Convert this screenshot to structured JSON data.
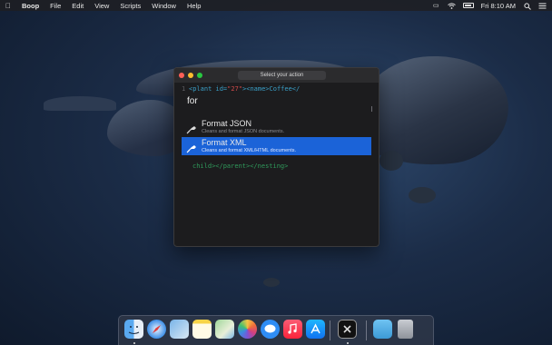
{
  "menubar": {
    "app_name": "Boop",
    "items": [
      "File",
      "Edit",
      "View",
      "Scripts",
      "Window",
      "Help"
    ],
    "clock": "Fri 8:10 AM"
  },
  "window": {
    "title": "Select your action",
    "code": {
      "line_number": "1",
      "line1": {
        "open_tag": "<plant id=",
        "attr_value": "\"27\"",
        "close": "><name>Coffee</"
      },
      "line2": "child></parent></nesting>"
    }
  },
  "palette": {
    "query": "for",
    "results": [
      {
        "title": "Format JSON",
        "description": "Cleans and format JSON documents."
      },
      {
        "title": "Format XML",
        "description": "Cleans and format XML/HTML documents."
      }
    ],
    "selected_index": 1
  },
  "dock": {
    "items": [
      "finder-icon",
      "safari-icon",
      "preview-icon",
      "notes-icon",
      "maps-icon",
      "photos-icon",
      "messages-icon",
      "music-icon",
      "app-store-icon",
      "boop-icon",
      "downloads-folder-icon",
      "trash-icon"
    ]
  },
  "colors": {
    "selection": "#1b63d8",
    "tag": "#3aa0c8",
    "attr_value": "#d04a4a"
  }
}
